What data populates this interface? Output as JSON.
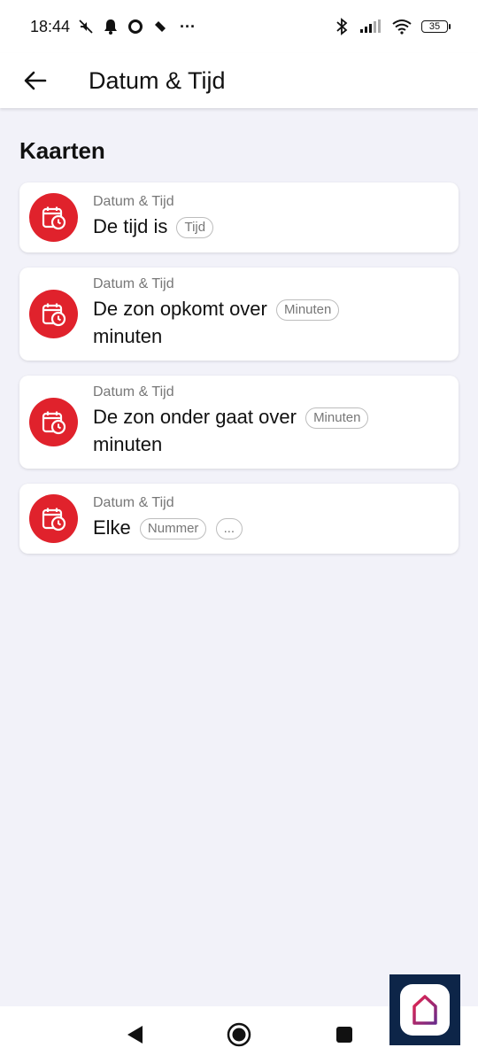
{
  "status_bar": {
    "time": "18:44",
    "battery": "35",
    "icons": [
      "mute-icon",
      "notification-bell-icon",
      "circle-icon",
      "cast-icon",
      "more-dots-icon",
      "bluetooth-icon",
      "cell-signal-icon",
      "wifi-icon",
      "battery-icon"
    ],
    "more": "···"
  },
  "app_bar": {
    "title": "Datum & Tijd",
    "back_icon": "arrow-left-icon"
  },
  "section": {
    "title": "Kaarten"
  },
  "cards": [
    {
      "category": "Datum & Tijd",
      "text": "De tijd is",
      "chips": [
        "Tijd"
      ],
      "text_after": ""
    },
    {
      "category": "Datum & Tijd",
      "text": "De zon opkomt over",
      "chips": [
        "Minuten"
      ],
      "text_after": "minuten"
    },
    {
      "category": "Datum & Tijd",
      "text": "De zon onder gaat over",
      "chips": [
        "Minuten"
      ],
      "text_after": "minuten"
    },
    {
      "category": "Datum & Tijd",
      "text": "Elke",
      "chips": [
        "Nummer",
        "..."
      ],
      "text_after": ""
    }
  ],
  "colors": {
    "accent": "#e0222c",
    "background": "#f2f2f9",
    "logo_bg": "#0d2548"
  }
}
